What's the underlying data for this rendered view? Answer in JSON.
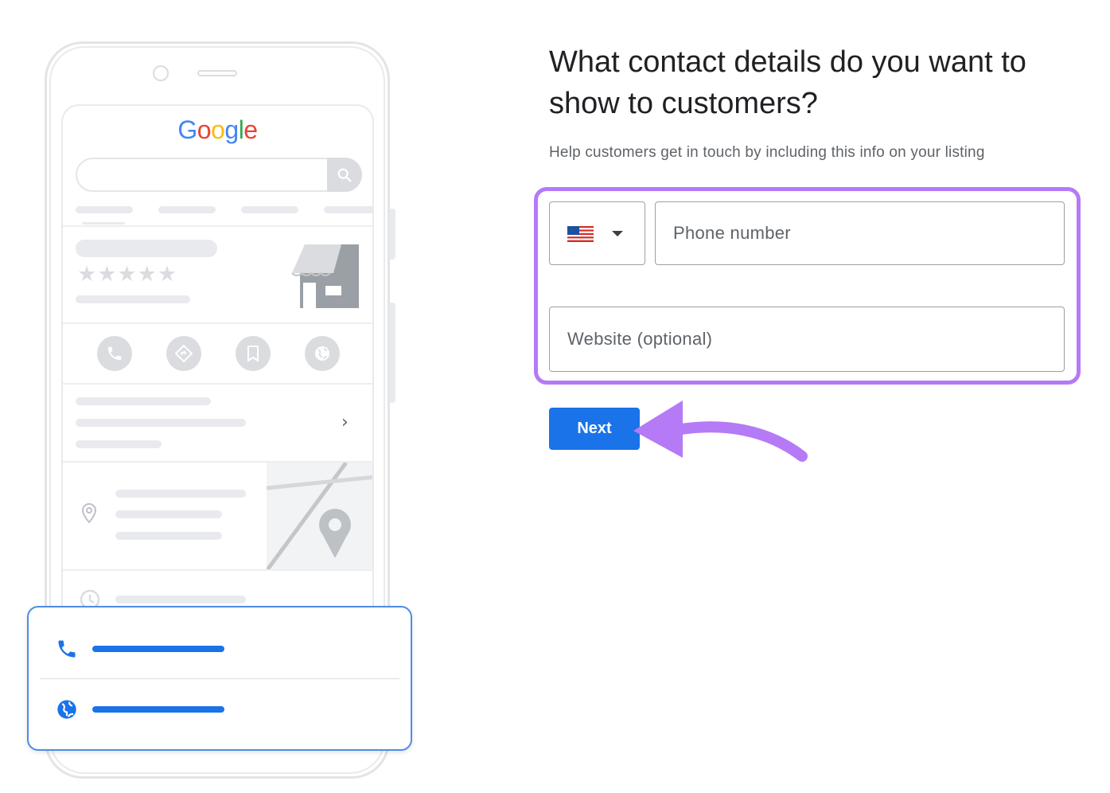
{
  "illustration": {
    "logo": {
      "letters": [
        {
          "char": "G",
          "color": "#4285F4"
        },
        {
          "char": "o",
          "color": "#EA4335"
        },
        {
          "char": "o",
          "color": "#FBBC05"
        },
        {
          "char": "g",
          "color": "#4285F4"
        },
        {
          "char": "l",
          "color": "#34A853"
        },
        {
          "char": "e",
          "color": "#EA4335"
        }
      ]
    },
    "rating_stars": "★★★★★",
    "action_icons": [
      "phone-icon",
      "directions-icon",
      "bookmark-icon",
      "website-icon"
    ],
    "chevron": "›",
    "contact_card": {
      "rows": [
        "phone-icon",
        "globe-icon"
      ],
      "accent_color": "#1a73e8"
    }
  },
  "form": {
    "title": "What contact details do you want to show to customers?",
    "subtitle": "Help customers get in touch by including this info on your listing",
    "country_selector": {
      "flag": "us-flag-icon",
      "caret": "dropdown-arrow-icon"
    },
    "phone": {
      "placeholder": "Phone number",
      "value": ""
    },
    "website": {
      "placeholder": "Website (optional)",
      "value": ""
    },
    "next_button": {
      "label": "Next"
    },
    "highlight_color": "#b57af6",
    "button_color": "#1a73e8"
  }
}
